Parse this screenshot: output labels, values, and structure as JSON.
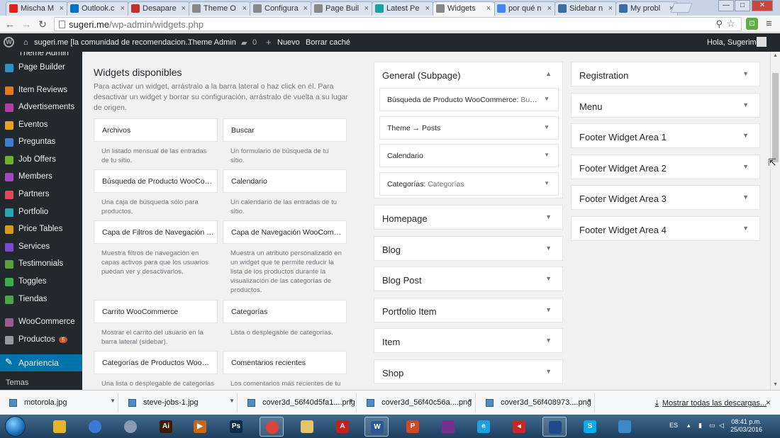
{
  "browser": {
    "tabs": [
      {
        "label": "Mischa M",
        "favicon_color": "#e62117",
        "favicon": "youtube-icon"
      },
      {
        "label": "Outlook.c",
        "favicon_color": "#0072c6",
        "favicon": "outlook-icon"
      },
      {
        "label": "Desapare",
        "favicon_color": "#c4302b",
        "favicon": "udemy-icon"
      },
      {
        "label": "Theme O",
        "favicon_color": "#888888",
        "favicon": "page-icon"
      },
      {
        "label": "Configura",
        "favicon_color": "#888888",
        "favicon": "page-icon"
      },
      {
        "label": "Page Buil",
        "favicon_color": "#888888",
        "favicon": "page-icon"
      },
      {
        "label": "Latest Pe",
        "favicon_color": "#1aa3a3",
        "favicon": "gt-icon"
      },
      {
        "label": "Widgets",
        "favicon_color": "#888888",
        "favicon": "page-icon",
        "active": true
      },
      {
        "label": "por qué n",
        "favicon_color": "#4285f4",
        "favicon": "google-icon"
      },
      {
        "label": "Sidebar n",
        "favicon_color": "#3a6ea5",
        "favicon": "oc-icon"
      },
      {
        "label": "My probl",
        "favicon_color": "#3a6ea5",
        "favicon": "oc-icon"
      }
    ],
    "tab_close": "×",
    "url_host": "sugeri.me",
    "url_path": "/wp-admin/widgets.php",
    "win_min": "—",
    "win_max": "□",
    "win_close": "✕"
  },
  "adminbar": {
    "site_name": "sugeri.me [la comunidad de recomendacion...",
    "theme_admin": "Theme Admin",
    "comments_count": "0",
    "new_label": "Nuevo",
    "cache_label": "Borrar caché",
    "greeting": "Hola, Sugerime"
  },
  "sidebar": {
    "top_partial": "Theme Admin",
    "items": [
      {
        "label": "Page Builder",
        "icon": "page-builder-icon",
        "color": "#2f8fc8"
      },
      {
        "label": "Item Reviews",
        "icon": "star-icon",
        "color": "#e07c1d"
      },
      {
        "label": "Advertisements",
        "icon": "ad-icon",
        "color": "#b23fa8"
      },
      {
        "label": "Eventos",
        "icon": "calendar-icon",
        "color": "#e8a11e"
      },
      {
        "label": "Preguntas",
        "icon": "question-icon",
        "color": "#3d7fd1"
      },
      {
        "label": "Job Offers",
        "icon": "briefcase-icon",
        "color": "#6fae2f"
      },
      {
        "label": "Members",
        "icon": "members-icon",
        "color": "#a349c6"
      },
      {
        "label": "Partners",
        "icon": "heart-icon",
        "color": "#e2485a"
      },
      {
        "label": "Portfolio",
        "icon": "portfolio-icon",
        "color": "#2aa6b3"
      },
      {
        "label": "Price Tables",
        "icon": "dollar-icon",
        "color": "#d99a14"
      },
      {
        "label": "Services",
        "icon": "gear-icon",
        "color": "#7a4ad1"
      },
      {
        "label": "Testimonials",
        "icon": "quote-icon",
        "color": "#5ca03c"
      },
      {
        "label": "Toggles",
        "icon": "toggle-icon",
        "color": "#3cad4a"
      },
      {
        "label": "Tiendas",
        "icon": "store-icon",
        "color": "#4aa64a"
      },
      {
        "label": "WooCommerce",
        "icon": "woocommerce-icon",
        "color": "#9b5c8f"
      },
      {
        "label": "Productos",
        "icon": "cart-icon",
        "color": "#9a9a9a",
        "badge": "5"
      },
      {
        "label": "Apariencia",
        "icon": "brush-icon",
        "color": "#ffffff",
        "active": true
      }
    ],
    "sub_item": "Temas"
  },
  "widgets": {
    "title": "Widgets disponibles",
    "description": "Para activar un widget, arrástralo a la barra lateral o haz click en él. Para desactivar un widget y borrar su configuración, arrástralo de vuelta a su lugar de origen.",
    "items": [
      {
        "title": "Archivos",
        "desc": "Un listado mensual de las entradas de tu sitio."
      },
      {
        "title": "Buscar",
        "desc": "Un formulario de búsqueda de tu sitio."
      },
      {
        "title": "Búsqueda de Producto WooCommerce",
        "desc": "Una caja de búsqueda sólo para productos."
      },
      {
        "title": "Calendario",
        "desc": "Un calendario de las entradas de tu sitio."
      },
      {
        "title": "Capa de Filtros de Navegación WooCommerce",
        "desc": "Muestra filtros de navegación en capas activos para que los usuarios puedan ver y desactivarlos."
      },
      {
        "title": "Capa de Navegación WooCommerce",
        "desc": "Muestra un atributo personalizado en un widget que te permite reducir la lista de los productos durante la visualización de las categorías de productos."
      },
      {
        "title": "Carrito WooCommerce",
        "desc": "Mostrar el carrito del usuario en la barra lateral (sidebar)."
      },
      {
        "title": "Categorías",
        "desc": "Lista o desplegable de categorías."
      },
      {
        "title": "Categorías de Productos WooCommerce",
        "desc": "Una lista o desplegable de categorías"
      },
      {
        "title": "Comentarios recientes",
        "desc": "Los comentarios más recientes de tu"
      }
    ]
  },
  "areas": {
    "general": {
      "title": "General (Subpage)",
      "inner": [
        {
          "title": "Búsqueda de Producto WooCommerce:",
          "sub": "Buscar"
        },
        {
          "title": "Theme → Posts",
          "sub": ""
        },
        {
          "title": "Calendario",
          "sub": ""
        },
        {
          "title": "Categorías:",
          "sub": "Categorías"
        }
      ]
    },
    "middle": [
      "Homepage",
      "Blog",
      "Blog Post",
      "Portfolio Item",
      "Item",
      "Shop"
    ],
    "right": [
      "Registration",
      "Menu",
      "Footer Widget Area 1",
      "Footer Widget Area 2",
      "Footer Widget Area 3",
      "Footer Widget Area 4"
    ]
  },
  "downloads": {
    "files": [
      "motorola.jpg",
      "steve-jobs-1.jpg",
      "cover3d_56f40d5fa1....png",
      "cover3d_56f40c56a....png",
      "cover3d_56f408973....png"
    ],
    "show_all": "Mostrar todas las descargas...",
    "close": "×"
  },
  "taskbar": {
    "apps": [
      {
        "name": "explorer-icon",
        "color": "#e7b52c",
        "glyph": ""
      },
      {
        "name": "chrome-canary-icon",
        "color": "#3a7bd5",
        "glyph": ""
      },
      {
        "name": "settings-app-icon",
        "color": "#8c9bb0",
        "glyph": ""
      },
      {
        "name": "illustrator-icon",
        "color": "#3d1a00",
        "glyph": "Ai"
      },
      {
        "name": "media-player-icon",
        "color": "#c66a1a",
        "glyph": "▶"
      },
      {
        "name": "photoshop-icon",
        "color": "#0c2c4a",
        "glyph": "Ps"
      },
      {
        "name": "chrome-icon",
        "color": "#db4437",
        "glyph": ""
      },
      {
        "name": "folder-icon",
        "color": "#e6c46a",
        "glyph": ""
      },
      {
        "name": "acrobat-icon",
        "color": "#c2201d",
        "glyph": "A"
      },
      {
        "name": "word-icon",
        "color": "#2b579a",
        "glyph": "W"
      },
      {
        "name": "powerpoint-icon",
        "color": "#d24726",
        "glyph": "P"
      },
      {
        "name": "winrar-icon",
        "color": "#7a2f8f",
        "glyph": ""
      },
      {
        "name": "ie-icon",
        "color": "#1ba1e2",
        "glyph": "e"
      },
      {
        "name": "git-icon",
        "color": "#c62828",
        "glyph": "◂"
      },
      {
        "name": "app-icon",
        "color": "#1e4a8a",
        "glyph": ""
      },
      {
        "name": "skype-icon",
        "color": "#00aff0",
        "glyph": "S"
      },
      {
        "name": "photos-icon",
        "color": "#3a8ac9",
        "glyph": ""
      }
    ],
    "lang": "ES",
    "time": "08:41 p.m.",
    "date": "25/03/2016"
  }
}
